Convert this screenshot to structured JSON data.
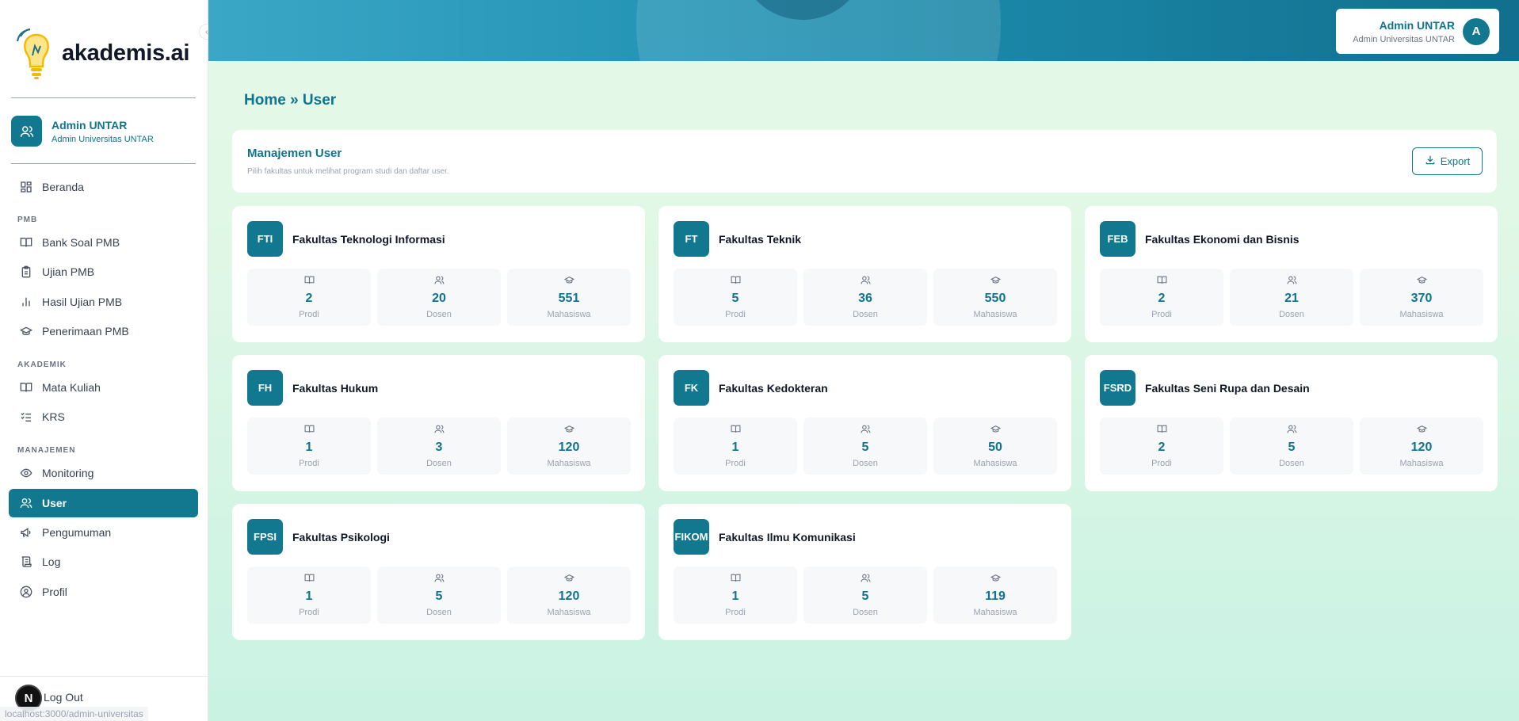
{
  "app": {
    "logo_text": "akademis.ai",
    "collapse_icon": "chevron-left-icon"
  },
  "sidebar": {
    "profile": {
      "name": "Admin UNTAR",
      "subtitle": "Admin Universitas UNTAR"
    },
    "top_item": {
      "label": "Beranda",
      "icon": "grid-icon"
    },
    "sections": [
      {
        "title": "PMB",
        "items": [
          {
            "label": "Bank Soal PMB",
            "icon": "book-icon"
          },
          {
            "label": "Ujian PMB",
            "icon": "clipboard-icon"
          },
          {
            "label": "Hasil Ujian PMB",
            "icon": "bar-chart-icon"
          },
          {
            "label": "Penerimaan PMB",
            "icon": "graduation-cap-icon"
          }
        ]
      },
      {
        "title": "AKADEMIK",
        "items": [
          {
            "label": "Mata Kuliah",
            "icon": "book-icon"
          },
          {
            "label": "KRS",
            "icon": "list-checks-icon"
          }
        ]
      },
      {
        "title": "MANAJEMEN",
        "items": [
          {
            "label": "Monitoring",
            "icon": "eye-icon"
          },
          {
            "label": "User",
            "icon": "users-icon",
            "active": true
          },
          {
            "label": "Pengumuman",
            "icon": "megaphone-icon"
          },
          {
            "label": "Log",
            "icon": "scroll-icon"
          },
          {
            "label": "Profil",
            "icon": "user-circle-icon"
          }
        ]
      }
    ],
    "logout_label": "Log Out",
    "status_url": "localhost:3000/admin-universitas"
  },
  "topbar": {
    "user_name": "Admin UNTAR",
    "user_subtitle": "Admin Universitas UNTAR",
    "avatar_letter": "A"
  },
  "breadcrumb": {
    "text": "Home » User"
  },
  "header": {
    "title": "Manajemen User",
    "subtitle": "Pilih fakultas untuk melihat program studi dan daftar user.",
    "export_label": "Export"
  },
  "stat_labels": {
    "prodi": "Prodi",
    "dosen": "Dosen",
    "mahasiswa": "Mahasiswa"
  },
  "faculties": [
    {
      "code": "FTI",
      "name": "Fakultas Teknologi Informasi",
      "prodi": "2",
      "dosen": "20",
      "mahasiswa": "551"
    },
    {
      "code": "FT",
      "name": "Fakultas Teknik",
      "prodi": "5",
      "dosen": "36",
      "mahasiswa": "550"
    },
    {
      "code": "FEB",
      "name": "Fakultas Ekonomi dan Bisnis",
      "prodi": "2",
      "dosen": "21",
      "mahasiswa": "370"
    },
    {
      "code": "FH",
      "name": "Fakultas Hukum",
      "prodi": "1",
      "dosen": "3",
      "mahasiswa": "120"
    },
    {
      "code": "FK",
      "name": "Fakultas Kedokteran",
      "prodi": "1",
      "dosen": "5",
      "mahasiswa": "50"
    },
    {
      "code": "FSRD",
      "name": "Fakultas Seni Rupa dan Desain",
      "prodi": "2",
      "dosen": "5",
      "mahasiswa": "120"
    },
    {
      "code": "FPSI",
      "name": "Fakultas Psikologi",
      "prodi": "1",
      "dosen": "5",
      "mahasiswa": "120"
    },
    {
      "code": "FIKOM",
      "name": "Fakultas Ilmu Komunikasi",
      "prodi": "1",
      "dosen": "5",
      "mahasiswa": "119"
    }
  ],
  "colors": {
    "primary": "#11788f",
    "primary_text": "#0e7490"
  }
}
